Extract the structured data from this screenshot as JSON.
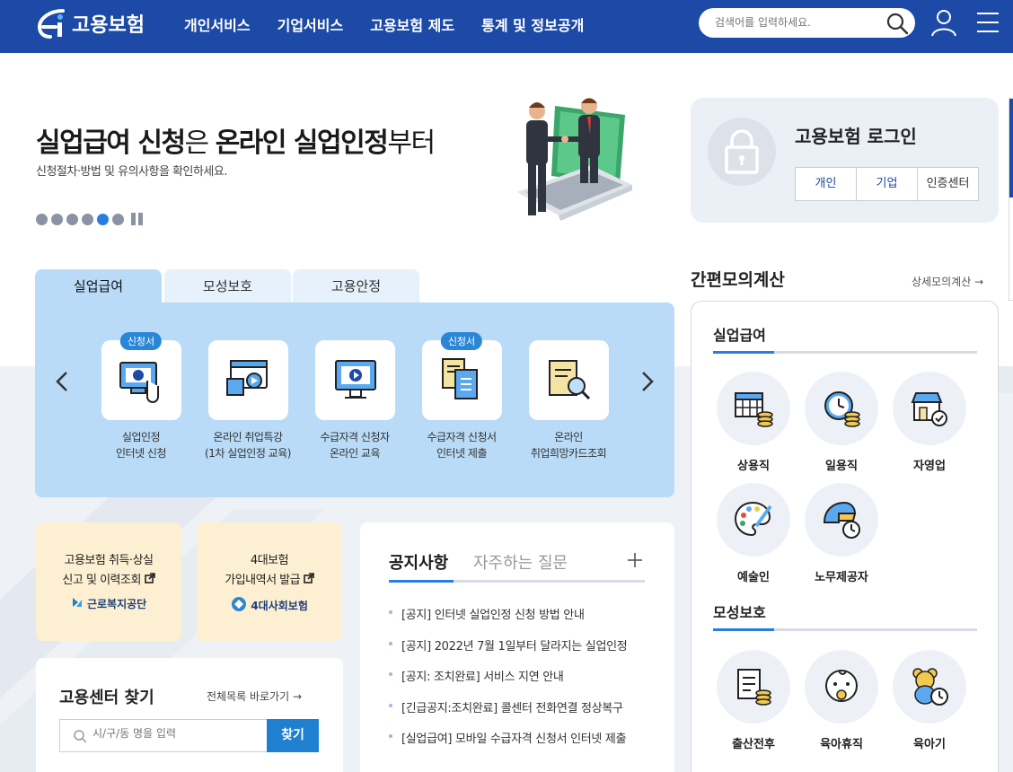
{
  "header": {
    "logo_text": "고용보험",
    "nav": [
      "개인서비스",
      "기업서비스",
      "고용보험 제도",
      "통계 및 정보공개"
    ],
    "search_placeholder": "검색어를 입력하세요."
  },
  "hero": {
    "title_strong_1": "실업급여 신청",
    "title_light_1": "은 ",
    "title_strong_2": "온라인 실업인정",
    "title_light_2": "부터",
    "subtitle": "신청절차·방법 및 유의사항을 확인하세요.",
    "slide_count": 6,
    "active_slide": 5
  },
  "login": {
    "title": "고용보험 로그인",
    "buttons": [
      "개인",
      "기업",
      "인증센터"
    ]
  },
  "tabs": {
    "labels": [
      "실업급여",
      "모성보호",
      "고용안정"
    ],
    "active": 0
  },
  "services": [
    {
      "badge": "신청서",
      "line1": "실업인정",
      "line2": "인터넷 신청"
    },
    {
      "badge": "",
      "line1": "온라인 취업특강",
      "line2": "(1차 실업인정 교육)"
    },
    {
      "badge": "",
      "line1": "수급자격 신청자",
      "line2": "온라인 교육"
    },
    {
      "badge": "신청서",
      "line1": "수급자격 신청서",
      "line2": "인터넷 제출"
    },
    {
      "badge": "",
      "line1": "온라인",
      "line2": "취업희망카드조회"
    }
  ],
  "cards": [
    {
      "line1": "고용보험 취득·상실",
      "line2": "신고 및 이력조회",
      "org": "근로복지공단"
    },
    {
      "line1": "4대보험",
      "line2": "가입내역서 발급",
      "org": "4대사회보험"
    }
  ],
  "center": {
    "title": "고용센터 찾기",
    "all_link": "전체목록 바로가기",
    "placeholder": "시/구/동 명을 입력",
    "button": "찾기"
  },
  "notice": {
    "tab_active": "공지사항",
    "tab_inactive": "자주하는 질문",
    "items": [
      "[공지] 인터넷 실업인정 신청 방법 안내",
      "[공지] 2022년 7월 1일부터 달라지는 실업인정",
      "[공지: 조치완료] 서비스 지연 안내",
      "[긴급공지:조치완료] 콜센터 전화연결 정상복구",
      "[실업급여] 모바일 수급자격 신청서 인터넷 제출"
    ]
  },
  "calculator": {
    "title": "간편모의계산",
    "more": "상세모의계산",
    "section1": "실업급여",
    "items1": [
      "상용직",
      "일용직",
      "자영업",
      "예술인",
      "노무제공자"
    ],
    "section2": "모성보호",
    "items2": [
      "출산전후",
      "육아휴직",
      "육아기"
    ]
  },
  "colors": {
    "header_bg": "#1d4aa6",
    "accent": "#2a7de0",
    "tab_panel": "#b9dbf7",
    "card_yellow": "#fdf0d2"
  }
}
